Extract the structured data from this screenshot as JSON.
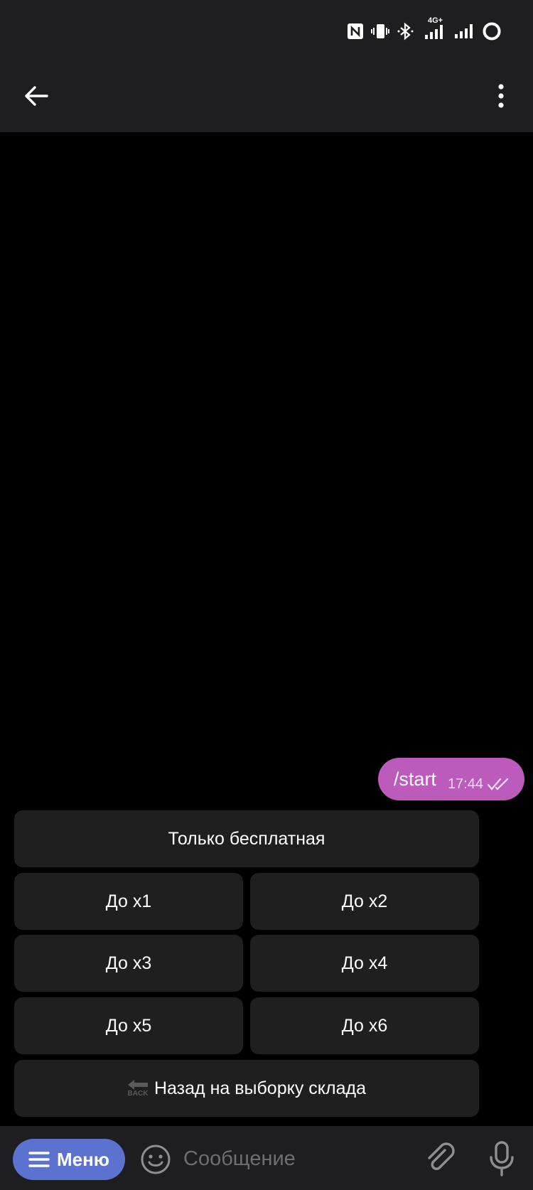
{
  "status_bar": {
    "network": "4G+",
    "icons": [
      "nfc-icon",
      "vibrate-icon",
      "bluetooth-icon",
      "signal-4g-icon",
      "signal-icon",
      "battery-ring-icon"
    ]
  },
  "header": {
    "back_icon": "arrow-left-icon",
    "more_icon": "vertical-dots-icon"
  },
  "message": {
    "text": "/start",
    "time": "17:44",
    "status_icon": "double-check-icon",
    "bubble_color": "#bd5bbd"
  },
  "keyboard": {
    "rows": [
      [
        "Только бесплатная"
      ],
      [
        "До x1",
        "До x2"
      ],
      [
        "До x3",
        "До x4"
      ],
      [
        "До x5",
        "До x6"
      ],
      [
        "Назад на выборку склада"
      ]
    ],
    "back_icon_label": "BACK"
  },
  "input_bar": {
    "menu_label": "Меню",
    "placeholder": "Сообщение",
    "menu_color": "#5b73cf"
  }
}
